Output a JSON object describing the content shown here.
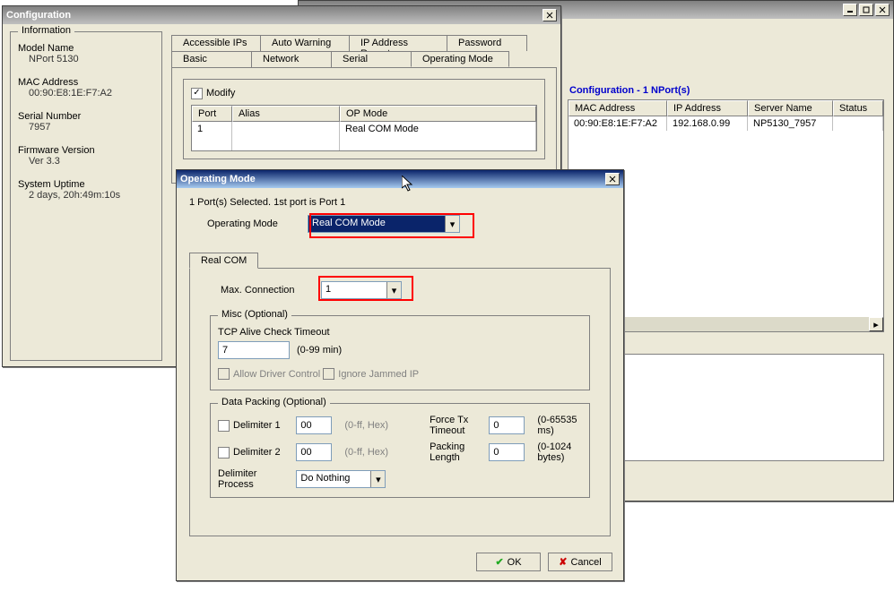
{
  "bgWindow": {
    "ctrlMin": "_",
    "ctrlMax": "□",
    "ctrlClose": "×",
    "panelTitle": "Configuration - 1 NPort(s)",
    "cols": {
      "mac": "MAC Address",
      "ip": "IP Address",
      "server": "Server Name",
      "status": "Status"
    },
    "row": {
      "mac": "00:90:E8:1E:F7:A2",
      "ip": "192.168.0.99",
      "server": "NP5130_7957",
      "status": ""
    }
  },
  "cfg": {
    "title": "Configuration",
    "close": "×",
    "info": {
      "legend": "Information",
      "modelLabel": "Model Name",
      "model": "NPort 5130",
      "macLabel": "MAC Address",
      "mac": "00:90:E8:1E:F7:A2",
      "serialLabel": "Serial Number",
      "serial": "7957",
      "fwLabel": "Firmware Version",
      "fw": "Ver 3.3",
      "uptimeLabel": "System Uptime",
      "uptime": "2 days, 20h:49m:10s"
    },
    "tabsTop": {
      "ips": "Accessible IPs",
      "warn": "Auto Warning",
      "ipr": "IP Address Report",
      "pwd": "Password"
    },
    "tabsBot": {
      "basic": "Basic",
      "net": "Network",
      "serial": "Serial",
      "op": "Operating Mode"
    },
    "modify": "Modify",
    "tableCols": {
      "port": "Port",
      "alias": "Alias",
      "op": "OP Mode"
    },
    "tableRow": {
      "port": "1",
      "alias": "",
      "op": "Real COM Mode"
    }
  },
  "op": {
    "title": "Operating Mode",
    "close": "×",
    "selected": "1 Port(s) Selected. 1st port is Port 1",
    "modeLabel": "Operating Mode",
    "modeVal": "Real COM Mode",
    "tab": "Real COM",
    "maxConnLabel": "Max. Connection",
    "maxConnVal": "1",
    "misc": {
      "legend": "Misc (Optional)",
      "tcpLabel": "TCP Alive Check Timeout",
      "tcpVal": "7",
      "tcpHint": "(0-99 min)",
      "allow": "Allow Driver Control",
      "ignore": "Ignore Jammed IP"
    },
    "pack": {
      "legend": "Data Packing (Optional)",
      "d1": "Delimiter 1",
      "d1v": "00",
      "hex": "(0-ff, Hex)",
      "d2": "Delimiter 2",
      "d2v": "00",
      "dp": "Delimiter Process",
      "dpv": "Do Nothing",
      "ft": "Force Tx Timeout",
      "ftv": "0",
      "fth": "(0-65535 ms)",
      "pl": "Packing Length",
      "plv": "0",
      "plh": "(0-1024 bytes)"
    },
    "ok": "OK",
    "cancel": "Cancel"
  }
}
